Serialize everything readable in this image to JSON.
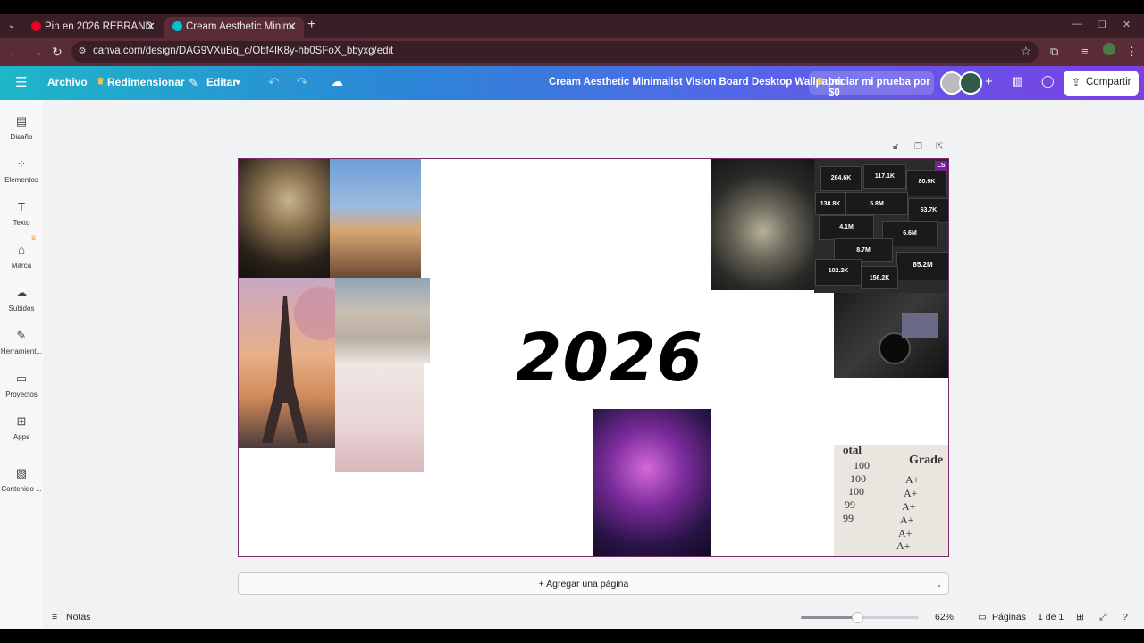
{
  "browser": {
    "tabs": [
      {
        "title": "Pin en 2026 REBRAND",
        "icon": "pinterest-icon",
        "color": "#e60023"
      },
      {
        "title": "Cream Aesthetic Minimalist Visi",
        "icon": "canva-icon",
        "color": "#00c4cc"
      }
    ],
    "url": "canva.com/design/DAG9VXuBq_c/Obf4lK8y-hb0SFoX_bbyxg/edit"
  },
  "toolbar": {
    "file_label": "Archivo",
    "resize_label": "Redimensionar",
    "edit_label": "Editar",
    "doc_title": "Cream Aesthetic Minimalist Vision Board Desktop Wallpaper",
    "trial_label": "Iniciar mi prueba por $0",
    "share_label": "Compartir"
  },
  "sidebar": {
    "items": [
      {
        "label": "Diseño",
        "icon": "layout-icon"
      },
      {
        "label": "Elementos",
        "icon": "shapes-icon"
      },
      {
        "label": "Texto",
        "icon": "text-icon"
      },
      {
        "label": "Marca",
        "icon": "brand-icon"
      },
      {
        "label": "Subidos",
        "icon": "upload-cloud-icon"
      },
      {
        "label": "Herramient...",
        "icon": "magic-tools-icon"
      },
      {
        "label": "Proyectos",
        "icon": "folder-icon"
      },
      {
        "label": "Apps",
        "icon": "apps-icon"
      },
      {
        "label": "Contenido ...",
        "icon": "media-icon"
      }
    ]
  },
  "canvas": {
    "headline": "2026",
    "stats": [
      "264.6K",
      "117.1K",
      "80.9K",
      "138.8K",
      "5.8M",
      "63.7K",
      "4.1M",
      "6.6M",
      "8.7M",
      "85.2M",
      "102.2K",
      "156.2K"
    ],
    "stats_badge": "LS",
    "grades": {
      "header_left": "otal",
      "header_right": "Grade",
      "rows": [
        {
          "score": "100",
          "grade": "A+"
        },
        {
          "score": "100",
          "grade": "A+"
        },
        {
          "score": "100",
          "grade": "A+"
        },
        {
          "score": "99",
          "grade": "A+"
        },
        {
          "score": "99",
          "grade": "A+"
        },
        {
          "score": "",
          "grade": "A+"
        }
      ]
    }
  },
  "footer": {
    "add_page_label": "+ Agregar una página",
    "notes_label": "Notas",
    "zoom_value": "62%",
    "zoom_fraction": 0.48,
    "pages_label": "Páginas",
    "page_count": "1 de 1"
  },
  "colors": {
    "accent_gradient_start": "#1fb6c9",
    "accent_gradient_end": "#7b3fe4",
    "selection_border": "#7a2b6e",
    "stats_up": "#22c55e"
  }
}
